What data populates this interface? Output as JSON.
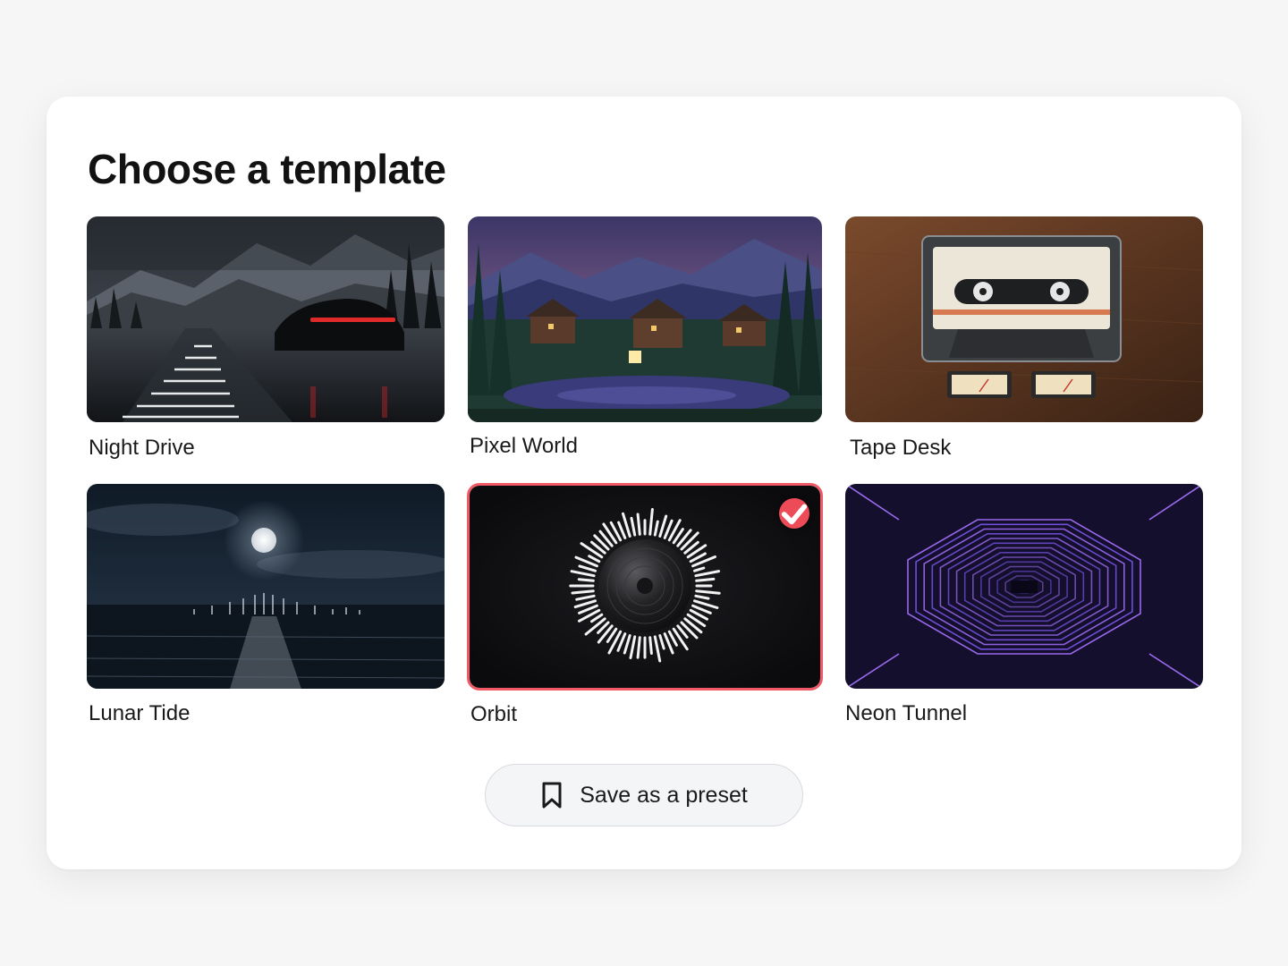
{
  "header": {
    "title": "Choose a template"
  },
  "templates": [
    {
      "label": "Night Drive",
      "image": "rainy-night-highway-car",
      "selected": false
    },
    {
      "label": "Pixel World",
      "image": "pixel-art-cabin-lake-twilight",
      "selected": false
    },
    {
      "label": "Tape Desk",
      "image": "cassette-tape-on-wood-desk",
      "selected": false
    },
    {
      "label": "Lunar Tide",
      "image": "moon-over-ocean-waveform",
      "selected": false
    },
    {
      "label": "Orbit",
      "image": "vinyl-record-radial-waveform",
      "selected": true
    },
    {
      "label": "Neon Tunnel",
      "image": "neon-octagon-tunnel",
      "selected": false
    }
  ],
  "actions": {
    "save_preset_label": "Save as a preset",
    "save_preset_icon": "bookmark-icon"
  },
  "colors": {
    "accent": "#ee4b58",
    "selected_border": "#ef5a66"
  }
}
